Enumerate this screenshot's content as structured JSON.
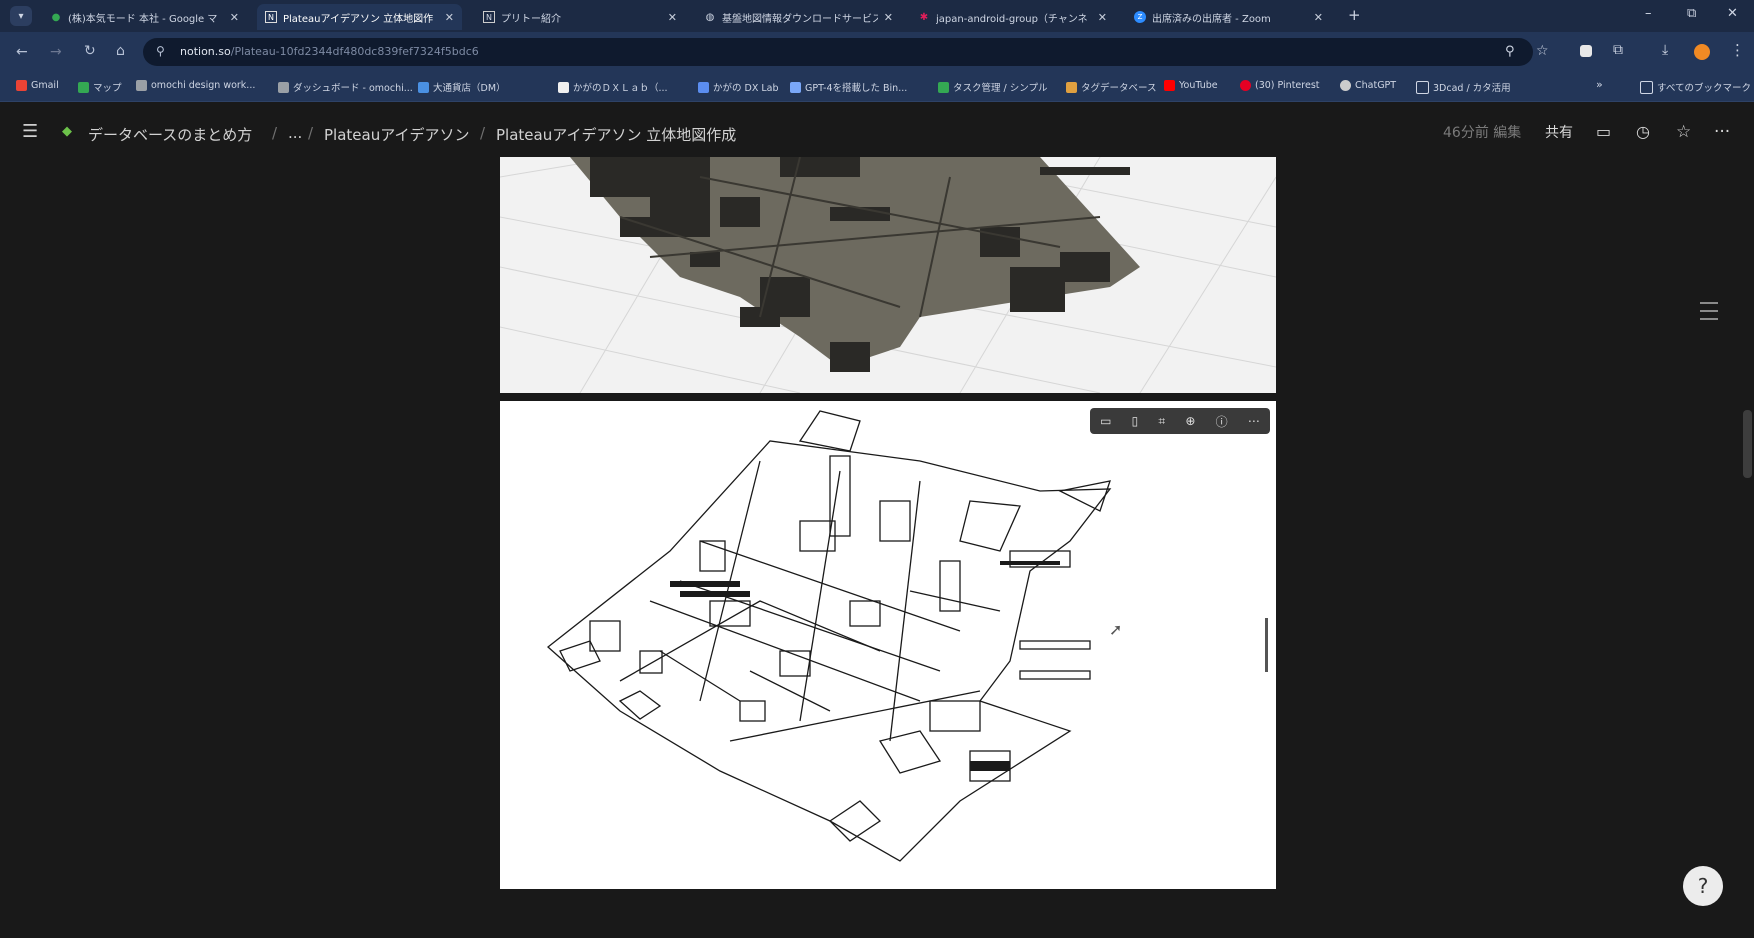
{
  "browser": {
    "tabs": [
      {
        "label": "(株)本気モード 本社 - Google マ",
        "icon": "map-pin-icon",
        "active": false
      },
      {
        "label": "Plateauアイデアソン 立体地図作",
        "icon": "notion-icon",
        "active": true
      },
      {
        "label": "プリトー紹介",
        "icon": "notion-icon",
        "active": false
      },
      {
        "label": "基盤地図情報ダウンロードサービス",
        "icon": "globe-icon",
        "active": false
      },
      {
        "label": "japan-android-group（チャンネ",
        "icon": "slack-icon",
        "active": false
      },
      {
        "label": "出席済みの出席者 - Zoom",
        "icon": "zoom-icon",
        "active": false
      }
    ],
    "new_tab": "+",
    "window_controls": {
      "minimize": "–",
      "restore": "⧉",
      "close": "✕"
    },
    "url_host": "notion.so",
    "url_path": "/Plateau-10fd2344df480dc839fef7324f5bdc6",
    "bookmarks": [
      {
        "label": "Gmail",
        "color": "#ea4335"
      },
      {
        "label": "マップ",
        "color": "#34a853"
      },
      {
        "label": "omochi design work...",
        "color": "#9aa0a6"
      },
      {
        "label": "ダッシュボード - omochi...",
        "color": "#9aa0a6"
      },
      {
        "label": "大通貨店（DM）",
        "color": "#4a90e2"
      },
      {
        "label": "かがのＤＸＬａｂ（...",
        "color": "#f0f0f0"
      },
      {
        "label": "かがの DX Lab",
        "color": "#5b8def"
      },
      {
        "label": "GPT-4を搭載した Bin...",
        "color": "#7aa7f7"
      },
      {
        "label": "タスク管理 / シンプル",
        "color": "#34a853"
      },
      {
        "label": "タグデータベース",
        "color": "#e0a040"
      },
      {
        "label": "YouTube",
        "color": "#ff0000"
      },
      {
        "label": "(30) Pinterest",
        "color": "#e60023"
      },
      {
        "label": "ChatGPT",
        "color": "#cccccc"
      },
      {
        "label": "3Dcad / カタ活用",
        "color": "#9aa0a6"
      },
      {
        "label": "すべてのブックマーク",
        "color": "#9aa0a6"
      }
    ]
  },
  "notion": {
    "breadcrumbs": [
      "データベースのまとめ方",
      "...",
      "Plateauアイデアソン",
      "Plateauアイデアソン 立体地図作成"
    ],
    "edited": "46分前 編集",
    "share": "共有"
  },
  "colors": {
    "accent": "#233658",
    "tabbar": "#1c2a44",
    "page_bg": "#191919"
  }
}
